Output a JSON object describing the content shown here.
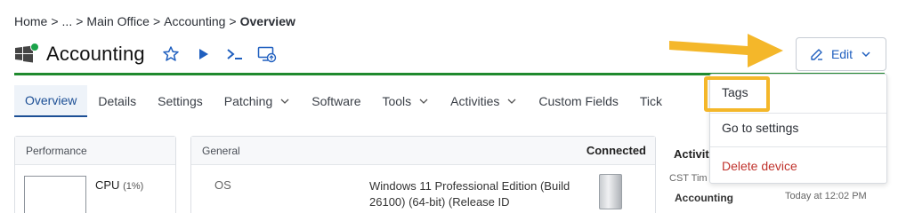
{
  "breadcrumb": {
    "home": "Home",
    "sep1": ">",
    "ellipsis": "...",
    "sep2": ">",
    "office": "Main Office",
    "sep3": ">",
    "section": "Accounting",
    "sep4": ">",
    "current": "Overview"
  },
  "header": {
    "title": "Accounting",
    "edit_label": "Edit"
  },
  "tabs": [
    {
      "label": "Overview"
    },
    {
      "label": "Details"
    },
    {
      "label": "Settings"
    },
    {
      "label": "Patching"
    },
    {
      "label": "Software"
    },
    {
      "label": "Tools"
    },
    {
      "label": "Activities"
    },
    {
      "label": "Custom Fields"
    },
    {
      "label": "Tick"
    }
  ],
  "dropdown": {
    "tags": "Tags",
    "settings": "Go to settings",
    "delete": "Delete device"
  },
  "performance": {
    "title": "Performance",
    "cpu": "CPU",
    "cpu_value": "(1%)"
  },
  "general": {
    "title": "General",
    "status": "Connected",
    "os_label": "OS",
    "os_value": "Windows 11 Professional Edition (Build 26100) (64-bit) (Release ID"
  },
  "activity": {
    "title": "Activiti",
    "tz": "CST Tim",
    "item": "Accounting",
    "time": "Today at 12:02 PM"
  },
  "colors": {
    "accent": "#1f5fbf",
    "status_green": "#1f8a2e",
    "highlight": "#f4b72a",
    "danger": "#c0332d"
  }
}
